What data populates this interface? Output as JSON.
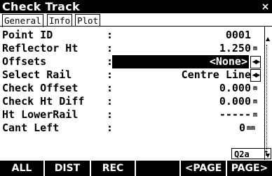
{
  "window": {
    "title": "Check Track",
    "close_glyph": "×"
  },
  "tabs": [
    {
      "label": "General",
      "active": true
    },
    {
      "label": "Info",
      "active": false
    },
    {
      "label": "Plot",
      "active": false
    }
  ],
  "fields": [
    {
      "label": "Point ID",
      "value": "0001",
      "unit": ""
    },
    {
      "label": "Reflector Ht",
      "value": "1.250",
      "unit": "m"
    },
    {
      "label": "Offsets",
      "value": "<None>",
      "unit": ""
    },
    {
      "label": "Select Rail",
      "value": "Centre Line",
      "unit": ""
    },
    {
      "label": "Check Offset",
      "value": "0.000",
      "unit": "m"
    },
    {
      "label": "Check Ht Diff",
      "value": "0.000",
      "unit": "m"
    },
    {
      "label": "Ht LowerRail",
      "value": "-----",
      "unit": "m"
    },
    {
      "label": "Cant Left",
      "value": "0",
      "unit": "mm"
    }
  ],
  "separator": ":",
  "status": {
    "text": "Q2a",
    "icon": "↑"
  },
  "softkeys": [
    "ALL",
    "DIST",
    "REC",
    "",
    "<PAGE",
    "PAGE>"
  ],
  "icons": {
    "scroll_up": "▲",
    "scroll_down": "▼",
    "selector": "◀▶"
  }
}
